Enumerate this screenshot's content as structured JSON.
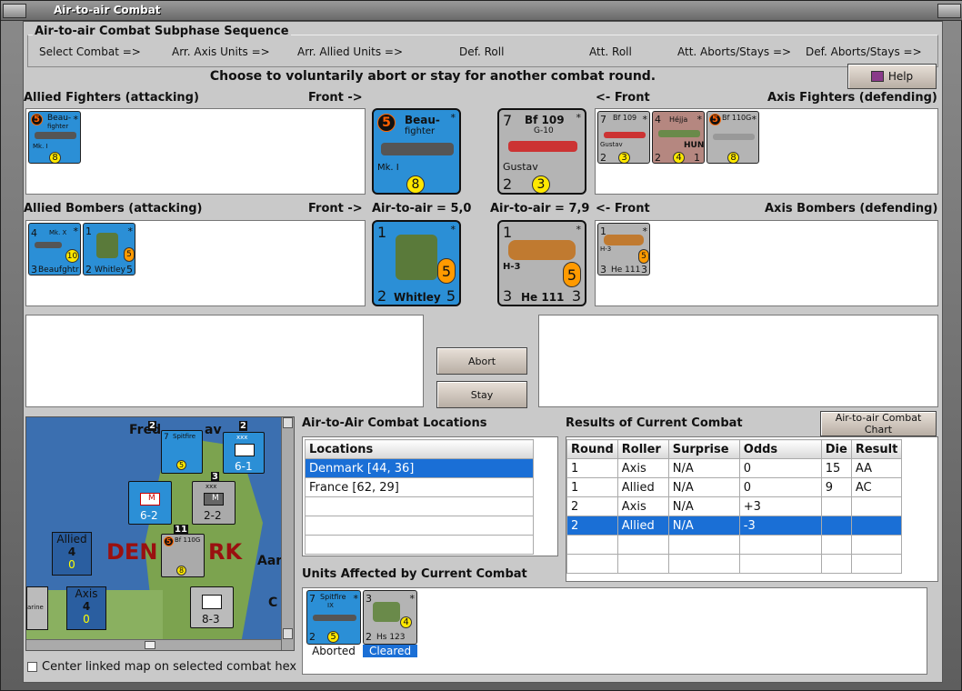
{
  "window": {
    "title": "Air-to-air Combat"
  },
  "sequence": {
    "title": "Air-to-air Combat Subphase Sequence",
    "steps": [
      "Select Combat =>",
      "Arr. Axis Units =>",
      "Arr. Allied Units =>",
      "Def. Roll",
      "Att. Roll",
      "Att. Aborts/Stays =>",
      "Def. Aborts/Stays =>"
    ]
  },
  "instruction": "Choose to voluntarily abort or stay for another combat round.",
  "help_label": "Help",
  "labels": {
    "allied_fighters": "Allied Fighters (attacking)",
    "front_right": "Front ->",
    "front_left": "<- Front",
    "axis_fighters": "Axis Fighters (defending)",
    "allied_bombers": "Allied Bombers (attacking)",
    "air_allied": "Air-to-air = 5,0",
    "air_axis": "Air-to-air = 7,9",
    "axis_bombers": "Axis Bombers (defending)"
  },
  "units": {
    "beau": {
      "name": "Beau-",
      "name2": "fighter",
      "mark": "Mk. I",
      "num": "5",
      "val": "8",
      "star": "*"
    },
    "bf109": {
      "name": "Bf 109",
      "sub": "G-10",
      "nick": "Gustav",
      "left": "7",
      "bl": "2",
      "val": "3",
      "star": "*"
    },
    "hejja": {
      "name": "Héjja",
      "hun": "HUN",
      "left": "4",
      "bl": "2",
      "val": "4",
      "br": "1",
      "star": "*"
    },
    "bf110": {
      "name": "Bf 110G",
      "num": "5",
      "val": "8",
      "star": "*"
    },
    "beaufighter": {
      "name": "Beaufghtr",
      "mark": "Mk. X",
      "left": "4",
      "bl": "3",
      "val": "10",
      "star": "*"
    },
    "whitley": {
      "name": "Whitley",
      "left": "1",
      "bl": "2",
      "br": "5",
      "val": "5",
      "star": "*"
    },
    "he111": {
      "name": "He 111",
      "sub": "H-3",
      "left": "1",
      "bl": "3",
      "br": "3",
      "val": "5",
      "star": "*"
    },
    "spitfire": {
      "name": "Spitfire",
      "sub": "IX",
      "left": "7",
      "bl": "2",
      "val": "5",
      "star": "*"
    },
    "hs123": {
      "name": "Hs 123",
      "left": "3",
      "bl": "2",
      "val": "4",
      "star": "*"
    }
  },
  "buttons": {
    "abort": "Abort",
    "stay": "Stay",
    "chart": "Air-to-air Combat Chart"
  },
  "locations": {
    "title": "Air-to-Air Combat Locations",
    "header": "Locations",
    "items": [
      "Denmark [44, 36]",
      "France [62, 29]"
    ]
  },
  "results": {
    "title": "Results of Current Combat",
    "columns": [
      "Round",
      "Roller",
      "Surprise",
      "Odds",
      "Die",
      "Result"
    ],
    "rows": [
      [
        "1",
        "Axis",
        "N/A",
        "0",
        "15",
        "AA"
      ],
      [
        "1",
        "Allied",
        "N/A",
        "0",
        "9",
        "AC"
      ],
      [
        "2",
        "Axis",
        "N/A",
        "+3",
        "",
        ""
      ],
      [
        "2",
        "Allied",
        "N/A",
        "-3",
        "",
        ""
      ]
    ]
  },
  "affected": {
    "title": "Units Affected by Current Combat",
    "aborted": "Aborted",
    "cleared": "Cleared"
  },
  "map": {
    "text_fred": "Fred",
    "text_av": "av",
    "text_den": "DEN",
    "text_rk": "RK",
    "text_aar": "Aar",
    "text_c": "C",
    "allied_label": "Allied",
    "allied_num": "4",
    "allied_zero": "0",
    "axis_label": "Axis",
    "axis_num": "4",
    "axis_zero": "0",
    "n2a": "2",
    "n2b": "2",
    "n3": "3",
    "n11": "11",
    "c61": "6-1",
    "c62": "6-2",
    "c22": "2-2",
    "c83": "8-3",
    "xxx": "xxx",
    "arine": "arine",
    "m": "M"
  },
  "checkbox_label": "Center linked map on selected combat hex"
}
